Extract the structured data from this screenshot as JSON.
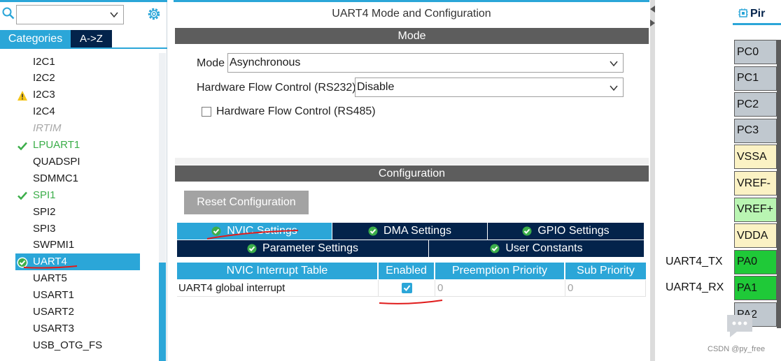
{
  "left": {
    "search_value": "",
    "tabs": {
      "categories": "Categories",
      "az": "A->Z"
    },
    "peripherals": [
      {
        "label": "I2C1",
        "state": "normal",
        "icon": ""
      },
      {
        "label": "I2C2",
        "state": "normal",
        "icon": ""
      },
      {
        "label": "I2C3",
        "state": "warning",
        "icon": "warning-icon"
      },
      {
        "label": "I2C4",
        "state": "normal",
        "icon": ""
      },
      {
        "label": "IRTIM",
        "state": "disabled",
        "icon": ""
      },
      {
        "label": "LPUART1",
        "state": "ok",
        "icon": "check-icon"
      },
      {
        "label": "QUADSPI",
        "state": "normal",
        "icon": ""
      },
      {
        "label": "SDMMC1",
        "state": "normal",
        "icon": ""
      },
      {
        "label": "SPI1",
        "state": "ok",
        "icon": "check-icon"
      },
      {
        "label": "SPI2",
        "state": "normal",
        "icon": ""
      },
      {
        "label": "SPI3",
        "state": "normal",
        "icon": ""
      },
      {
        "label": "SWPMI1",
        "state": "normal",
        "icon": ""
      },
      {
        "label": "UART4",
        "state": "selected",
        "icon": "check-circle-icon"
      },
      {
        "label": "UART5",
        "state": "normal",
        "icon": ""
      },
      {
        "label": "USART1",
        "state": "normal",
        "icon": ""
      },
      {
        "label": "USART2",
        "state": "normal",
        "icon": ""
      },
      {
        "label": "USART3",
        "state": "normal",
        "icon": ""
      },
      {
        "label": "USB_OTG_FS",
        "state": "normal",
        "icon": ""
      }
    ]
  },
  "mid": {
    "title": "UART4 Mode and Configuration",
    "mode_section": "Mode",
    "mode_label": "Mode",
    "mode_value": "Asynchronous",
    "hfc232_label": "Hardware Flow Control (RS232)",
    "hfc232_value": "Disable",
    "hfc485_label": "Hardware Flow Control (RS485)",
    "config_section": "Configuration",
    "reset_button": "Reset Configuration",
    "tabs": [
      {
        "label": "NVIC Settings",
        "active": true
      },
      {
        "label": "DMA Settings",
        "active": false
      },
      {
        "label": "GPIO Settings",
        "active": false
      },
      {
        "label": "Parameter Settings",
        "active": false
      },
      {
        "label": "User Constants",
        "active": false
      }
    ],
    "table": {
      "headers": [
        "NVIC Interrupt Table",
        "Enabled",
        "Preemption Priority",
        "Sub Priority"
      ],
      "rows": [
        {
          "name": "UART4 global interrupt",
          "enabled": true,
          "preemption": "0",
          "sub": "0"
        }
      ]
    }
  },
  "right": {
    "header": "Pir",
    "pins": [
      {
        "label": "PC0",
        "color": "#c0c8cf"
      },
      {
        "label": "PC1",
        "color": "#c0c8cf"
      },
      {
        "label": "PC2",
        "color": "#c0c8cf"
      },
      {
        "label": "PC3",
        "color": "#c0c8cf"
      },
      {
        "label": "VSSA",
        "color": "#fbf2c4"
      },
      {
        "label": "VREF-",
        "color": "#fbf2c4"
      },
      {
        "label": "VREF+",
        "color": "#b9f5b2"
      },
      {
        "label": "VDDA",
        "color": "#fbf2c4"
      },
      {
        "label": "PA0",
        "color": "#1fc938"
      },
      {
        "label": "PA1",
        "color": "#1fc938"
      },
      {
        "label": "PA2",
        "color": "#c0c8cf"
      }
    ],
    "signals": [
      {
        "label": "UART4_TX",
        "pin": "PA0"
      },
      {
        "label": "UART4_RX",
        "pin": "PA1"
      }
    ],
    "watermark": "CSDN @py_free"
  },
  "colors": {
    "accent": "#2ba6d8",
    "navy": "#03234b",
    "ok_green": "#3cae4a",
    "annotation_red": "#e01b1b"
  }
}
